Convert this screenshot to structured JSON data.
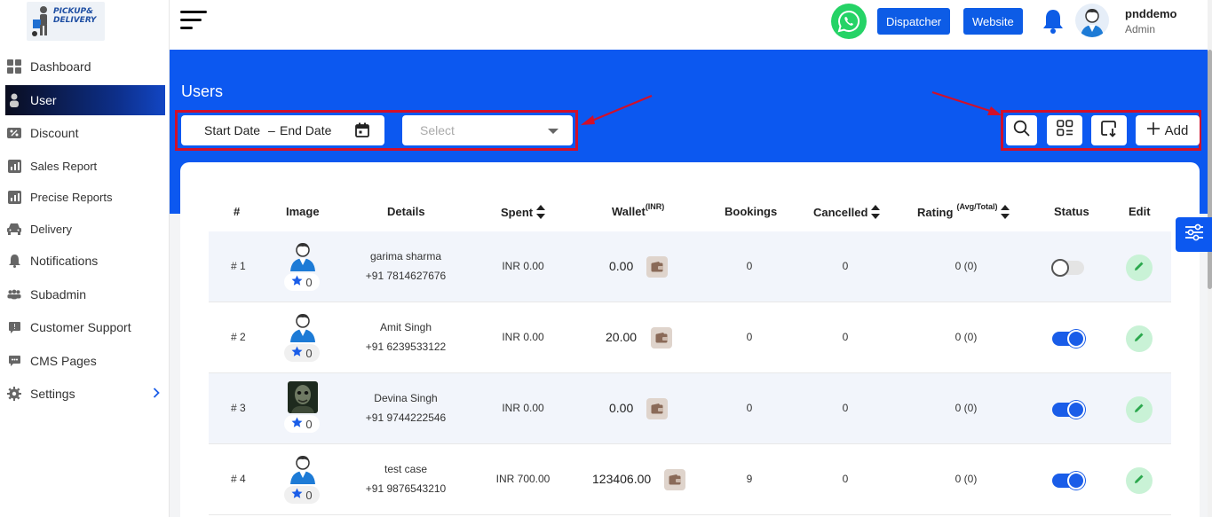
{
  "brand": {
    "logo_text_line1": "PICKUP&",
    "logo_text_line2": "DELIVERY"
  },
  "sidebar": {
    "items": [
      {
        "label": "Dashboard",
        "icon": "dashboard-icon"
      },
      {
        "label": "User",
        "icon": "user-icon",
        "active": true
      },
      {
        "label": "Discount",
        "icon": "discount-icon"
      },
      {
        "label": "Sales Report",
        "icon": "report-icon"
      },
      {
        "label": "Precise Reports",
        "icon": "report-icon"
      },
      {
        "label": "Delivery",
        "icon": "car-icon"
      },
      {
        "label": "Notifications",
        "icon": "bell-icon"
      },
      {
        "label": "Subadmin",
        "icon": "group-icon"
      },
      {
        "label": "Customer Support",
        "icon": "support-icon"
      },
      {
        "label": "CMS Pages",
        "icon": "chat-icon"
      },
      {
        "label": "Settings",
        "icon": "gear-icon"
      }
    ]
  },
  "header": {
    "dispatcher_label": "Dispatcher",
    "website_label": "Website",
    "user_name": "pnddemo",
    "user_role": "Admin"
  },
  "page": {
    "title": "Users"
  },
  "filters": {
    "start_date": "Start Date",
    "separator": "–",
    "end_date": "End Date",
    "select_placeholder": "Select"
  },
  "actions": {
    "add_label": "Add"
  },
  "table": {
    "headers": {
      "num": "#",
      "image": "Image",
      "details": "Details",
      "spent": "Spent",
      "wallet": "Wallet",
      "wallet_sup": "(INR)",
      "bookings": "Bookings",
      "cancelled": "Cancelled",
      "rating": "Rating",
      "rating_sup": "(Avg/Total)",
      "status": "Status",
      "edit": "Edit"
    },
    "rows": [
      {
        "num": "# 1",
        "rating_badge": "0",
        "name": "garima sharma",
        "phone": "+91 7814627676",
        "spent": "INR 0.00",
        "wallet": "0.00",
        "bookings": "0",
        "cancelled": "0",
        "rating": "0 (0)",
        "status": "off",
        "avatar": "default"
      },
      {
        "num": "# 2",
        "rating_badge": "0",
        "name": "Amit Singh",
        "phone": "+91 6239533122",
        "spent": "INR 0.00",
        "wallet": "20.00",
        "bookings": "0",
        "cancelled": "0",
        "rating": "0 (0)",
        "status": "on",
        "avatar": "default"
      },
      {
        "num": "# 3",
        "rating_badge": "0",
        "name": "Devina Singh",
        "phone": "+91 9744222546",
        "spent": "INR 0.00",
        "wallet": "0.00",
        "bookings": "0",
        "cancelled": "0",
        "rating": "0 (0)",
        "status": "on",
        "avatar": "photo"
      },
      {
        "num": "# 4",
        "rating_badge": "0",
        "name": "test case",
        "phone": "+91 9876543210",
        "spent": "INR 700.00",
        "wallet": "123406.00",
        "bookings": "9",
        "cancelled": "0",
        "rating": "0 (0)",
        "status": "on",
        "avatar": "default"
      }
    ]
  },
  "colors": {
    "primary": "#0c58f0",
    "highlight_border": "#d0102b",
    "whatsapp": "#25d366",
    "edit_bg": "#c9f2d6"
  }
}
